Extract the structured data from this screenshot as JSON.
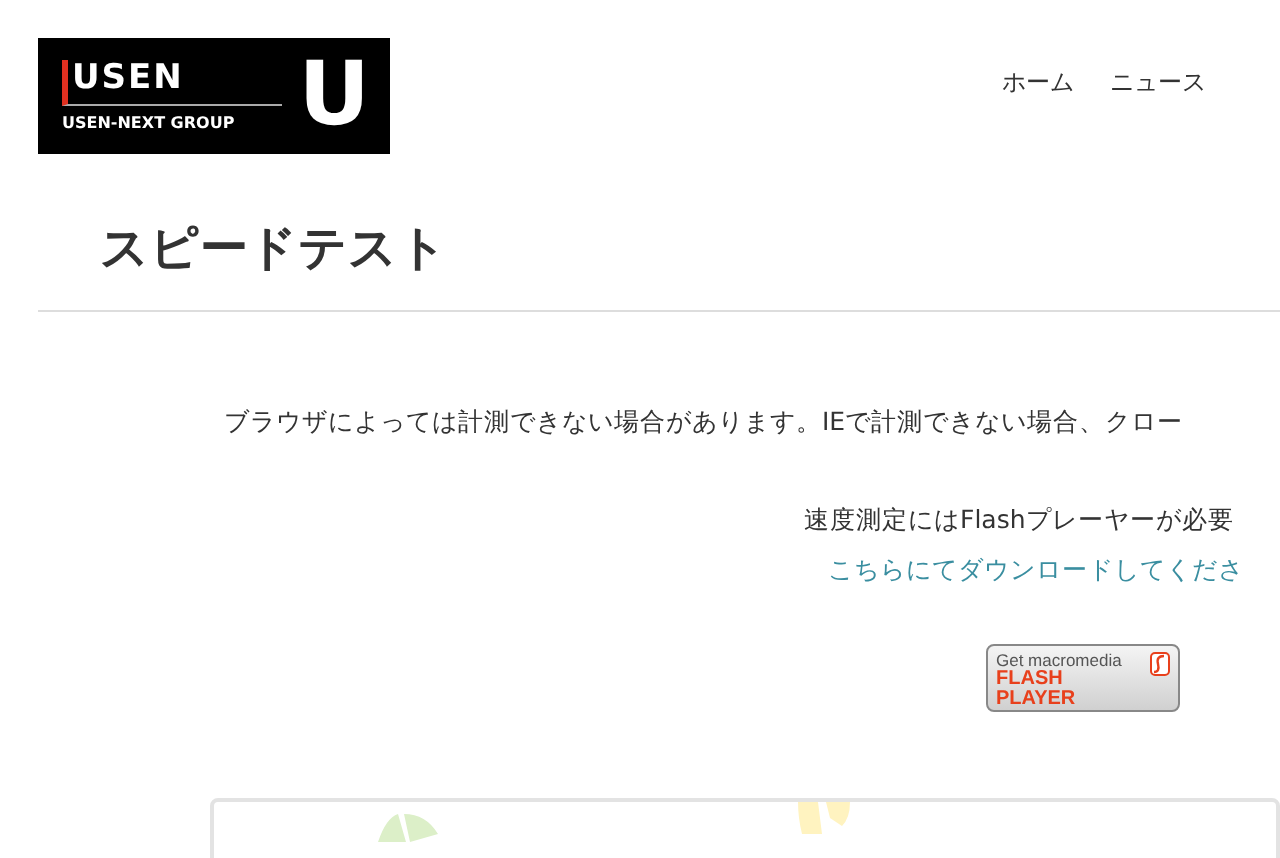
{
  "logo": {
    "wordmark": "USEN",
    "group": "USEN-NEXT GROUP",
    "mark": "U"
  },
  "nav": [
    {
      "label": "ホーム"
    },
    {
      "label": "ニュース"
    }
  ],
  "page_title": "スピードテスト",
  "notice": "ブラウザによっては計測できない場合があります。IEで計測できない場合、クロー",
  "flash_note": "速度測定にはFlashプレーヤーが必要",
  "download_link": "こちらにてダウンロードしてくださ",
  "flash_badge": {
    "top": "Get macromedia",
    "line_1": "FLASH",
    "line_2": "PLAYER"
  }
}
